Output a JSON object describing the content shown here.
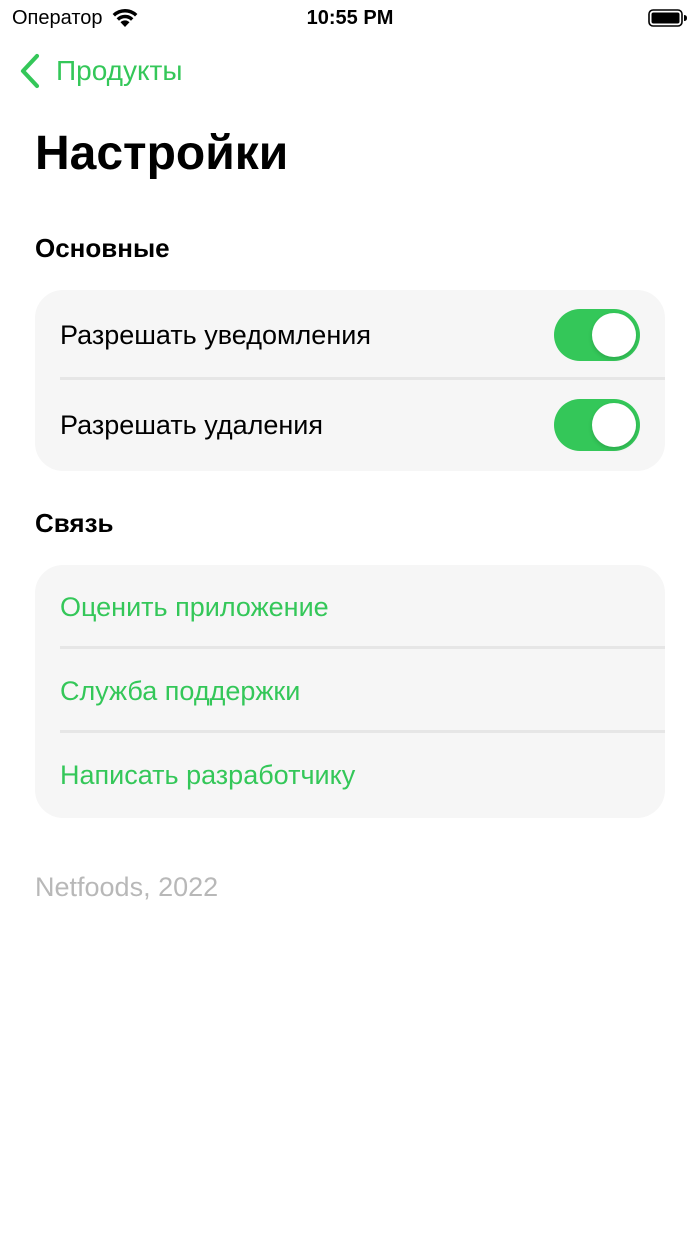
{
  "status_bar": {
    "carrier": "Оператор",
    "time": "10:55 PM",
    "wifi_icon": "wifi-icon",
    "battery_icon": "battery-icon"
  },
  "nav": {
    "back_label": "Продукты",
    "back_icon": "chevron-left-icon"
  },
  "title": "Настройки",
  "sections": {
    "main": {
      "header": "Основные",
      "rows": [
        {
          "label": "Разрешать уведомления",
          "toggle_on": true
        },
        {
          "label": "Разрешать удаления",
          "toggle_on": true
        }
      ]
    },
    "contact": {
      "header": "Связь",
      "rows": [
        {
          "label": "Оценить приложение"
        },
        {
          "label": "Служба поддержки"
        },
        {
          "label": "Написать разработчику"
        }
      ]
    }
  },
  "footer": "Netfoods, 2022",
  "colors": {
    "accent": "#34c759",
    "group_background": "#f6f6f6",
    "footer_text": "#b8b8b8"
  }
}
